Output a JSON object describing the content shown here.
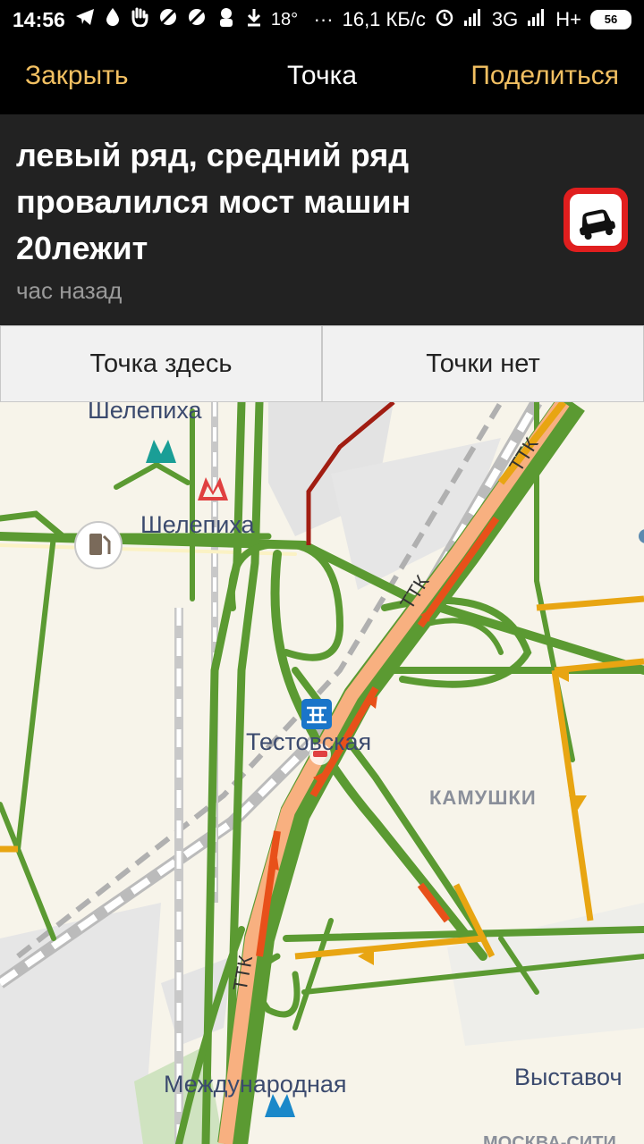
{
  "status_bar": {
    "time": "14:56",
    "temperature": "18°",
    "dots": "···",
    "speed": "16,1 КБ/с",
    "network1": "3G",
    "network2": "H+",
    "battery": "56"
  },
  "app_bar": {
    "close_label": "Закрыть",
    "title": "Точка",
    "share_label": "Поделиться"
  },
  "event": {
    "text": "левый ряд, средний ряд провалился мост машин 20лежит",
    "time_ago": "час назад"
  },
  "actions": {
    "here_label": "Точка здесь",
    "not_here_label": "Точки нет"
  },
  "map": {
    "labels": {
      "shelepikha_top": "Шелепиха",
      "shelepikha": "Шелепиха",
      "testovskaya": "Тестовская",
      "kamushki": "КАМУШКИ",
      "mezhdunarodnaya": "Международная",
      "vystavochnaya": "Выставоч",
      "moskva_city": "МОСКВА-СИТИ",
      "ttk_1": "ТТК",
      "ttk_2": "ТТК",
      "ttk_3": "ТТК"
    }
  },
  "colors": {
    "accent": "#f2c062",
    "traffic_green": "#5b9a32",
    "traffic_orange": "#e8a512",
    "traffic_red": "#e8501a",
    "accident_red": "#e01e1e"
  }
}
